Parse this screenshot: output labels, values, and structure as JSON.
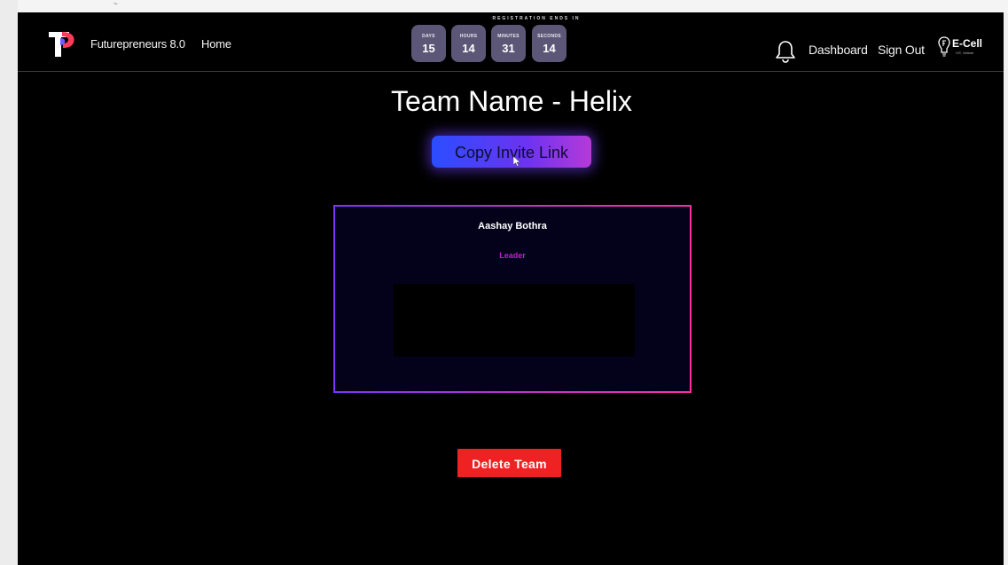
{
  "nav": {
    "brand": "Futurepreneurs 8.0",
    "home": "Home",
    "dashboard": "Dashboard",
    "sign_out": "Sign Out"
  },
  "countdown": {
    "title": "REGISTRATION ENDS IN",
    "units": [
      {
        "label": "DAYS",
        "value": "15"
      },
      {
        "label": "HOURS",
        "value": "14"
      },
      {
        "label": "MINUTES",
        "value": "31"
      },
      {
        "label": "SECONDS",
        "value": "14"
      }
    ]
  },
  "logo": {
    "ecell": "E-Cell",
    "ecell_sub": "VIT, Vellore"
  },
  "team": {
    "title": "Team Name - Helix",
    "copy_invite_label": "Copy Invite Link",
    "delete_label": "Delete Team",
    "members": [
      {
        "name": "Aashay Bothra",
        "role": "Leader"
      }
    ]
  },
  "colors": {
    "background": "#000000",
    "invite_gradient_start": "#2b4dff",
    "invite_gradient_end": "#b53ad8",
    "card_border_start": "#7b35ff",
    "card_border_end": "#ff2fa0",
    "role_color": "#c21ed2",
    "delete_button": "#ee2222",
    "timer_box": "#5c5776"
  },
  "icons": {
    "logo": "futurepreneurs-logo-icon",
    "bell": "bell-icon",
    "ecell": "ecell-logo-icon",
    "cursor": "mouse-cursor-icon"
  }
}
